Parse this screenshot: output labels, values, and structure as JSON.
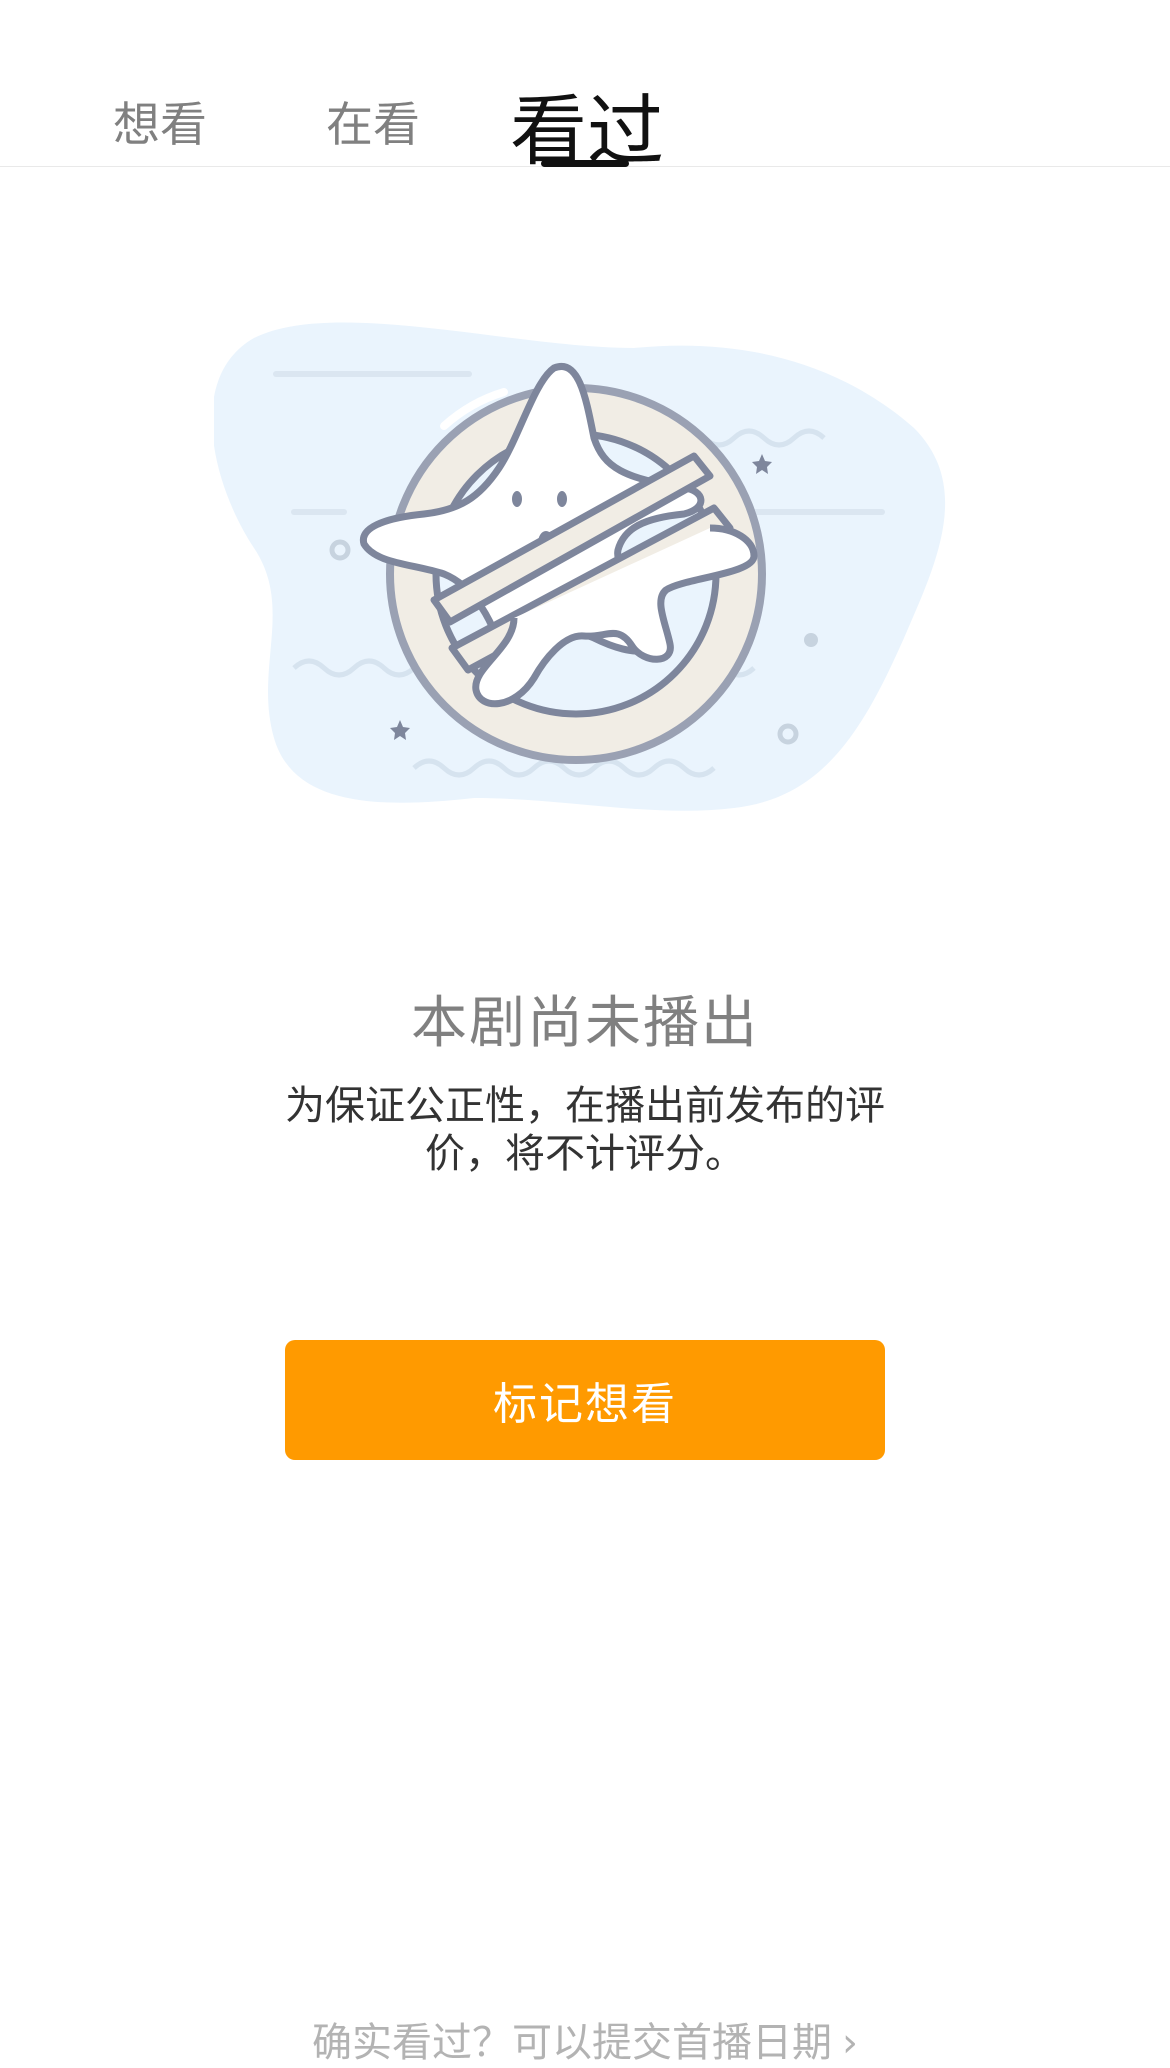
{
  "tabs": [
    {
      "label": "想看"
    },
    {
      "label": "在看"
    },
    {
      "label": "看过",
      "selected": true
    }
  ],
  "empty_state": {
    "title": "本剧尚未播出",
    "description": "为保证公正性，在播出前发布的评价，将不计评分。"
  },
  "primary_button": {
    "label": "标记想看",
    "color": "#FF9A00"
  },
  "bottom_link": {
    "label": "确实看过？可以提交首播日期",
    "icon": "chevron-right-icon"
  },
  "colors": {
    "accent": "#FF9A00",
    "illustration_bg": "#EAF4FD",
    "stroke": "#7E869C"
  }
}
